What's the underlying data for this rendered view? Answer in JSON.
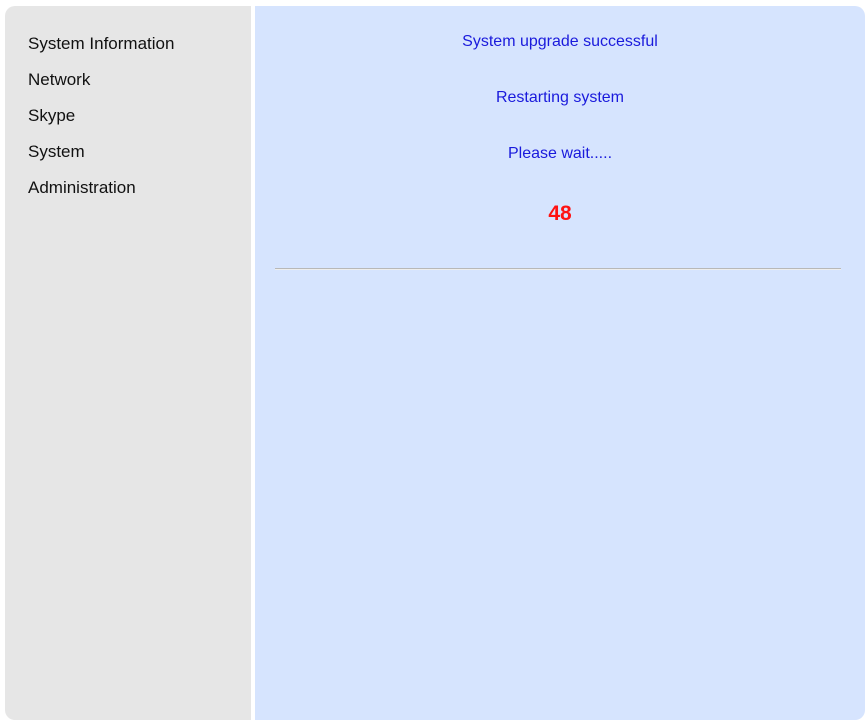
{
  "sidebar": {
    "items": [
      {
        "label": "System Information"
      },
      {
        "label": "Network"
      },
      {
        "label": "Skype"
      },
      {
        "label": "System"
      },
      {
        "label": "Administration"
      }
    ]
  },
  "main": {
    "messages": [
      "System upgrade successful",
      "Restarting system",
      "Please wait....."
    ],
    "countdown": "48"
  },
  "colors": {
    "sidebar_bg": "#e6e6e6",
    "main_bg": "#d6e4fe",
    "message_text": "#1a1adc",
    "countdown_text": "#ff1212"
  }
}
